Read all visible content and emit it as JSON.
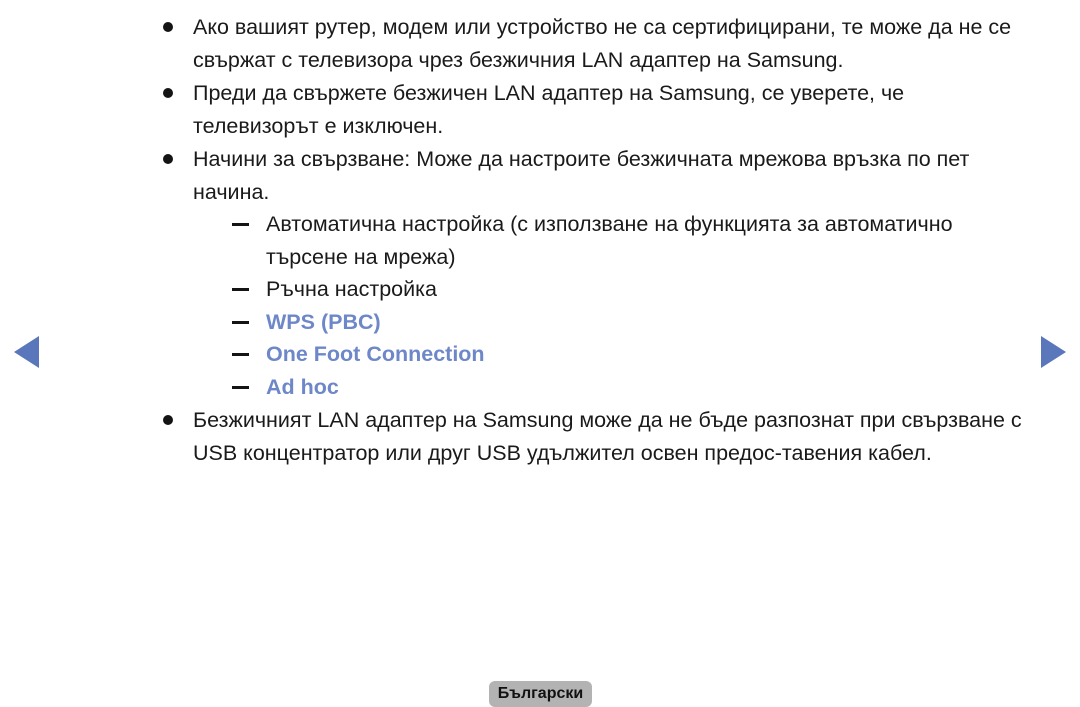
{
  "page": {
    "background_color": "#ffffff",
    "text_color": "#1a1a1a",
    "link_color": "#6d87c8",
    "arrow_color": "#5a77bb"
  },
  "navigation": {
    "prev_label": "◀",
    "next_label": "▶",
    "prev_name": "previous-page-arrow",
    "next_name": "next-page-arrow"
  },
  "content": {
    "bullets": [
      {
        "text": "Ако вашият рутер, модем или устройство не са сертифицирани, те може да не се свържат с телевизора чрез безжичния LAN адаптер на Samsung."
      },
      {
        "text": "Преди да свържете безжичен LAN адаптер на Samsung, се уверете, че телевизорът е изключен."
      },
      {
        "text": "Начини за свързване: Може да настроите безжичната мрежова връзка по пет начина."
      },
      {
        "text": "Безжичният LAN адаптер на Samsung може да не бъде разпознат при свързване с USB концентратор или друг USB удължител освен предос-тавения кабел."
      }
    ],
    "sub_items": [
      {
        "text": "Автоматична настройка (с използване на функцията за автоматично търсене на мрежа)",
        "is_link": false
      },
      {
        "text": "Ръчна настройка",
        "is_link": false
      },
      {
        "text": "WPS (PBC)",
        "is_link": true
      },
      {
        "text": "One Foot Connection",
        "is_link": true
      },
      {
        "text": "Ad hoc",
        "is_link": true
      }
    ]
  },
  "footer": {
    "language_label": "Български"
  }
}
